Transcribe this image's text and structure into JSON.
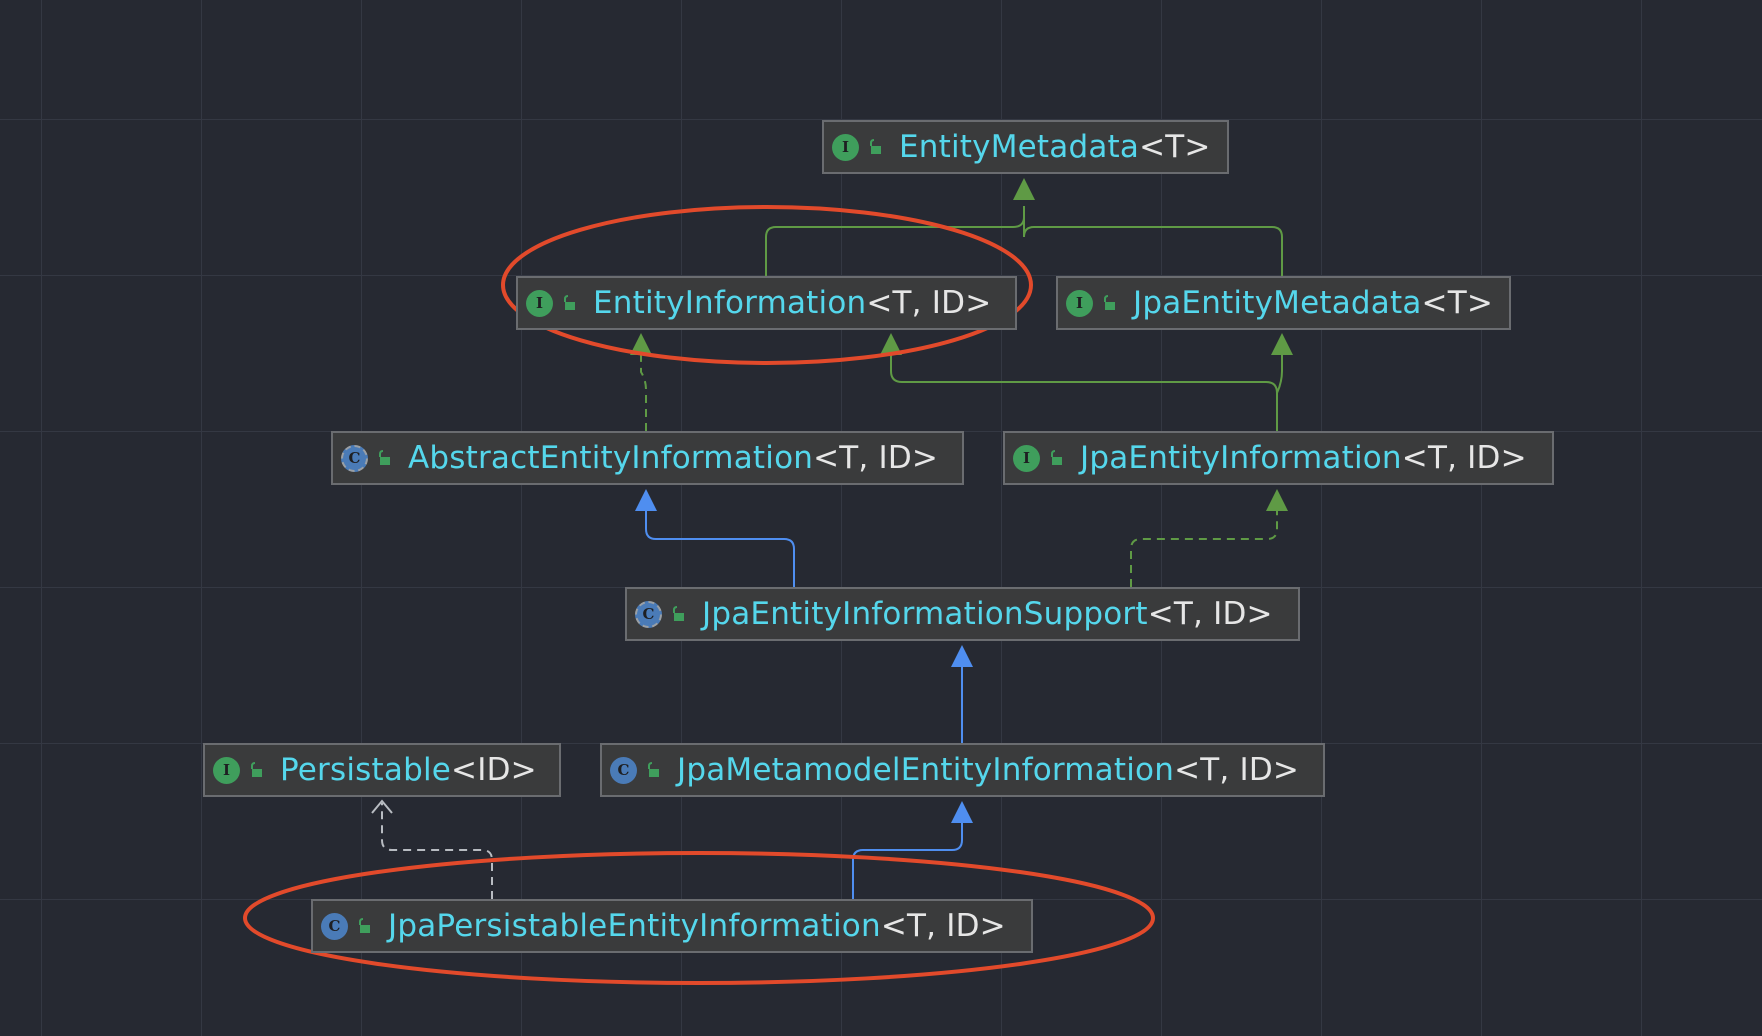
{
  "colors": {
    "background": "#262932",
    "grid": "#343843",
    "implements_edge": "#5f9a45",
    "extends_edge": "#4f8ef0",
    "dependency_edge": "#b8bcc2",
    "highlight": "#e24a2b",
    "class_name": "#55d7ec",
    "generics": "#e6e6e6"
  },
  "nodes": [
    {
      "id": "entity_metadata",
      "kind": "interface",
      "kind_letter": "I",
      "name": "EntityMetadata",
      "generics": "<T>"
    },
    {
      "id": "entity_information",
      "kind": "interface",
      "kind_letter": "I",
      "name": "EntityInformation",
      "generics": "<T, ID>"
    },
    {
      "id": "jpa_entity_metadata",
      "kind": "interface",
      "kind_letter": "I",
      "name": "JpaEntityMetadata",
      "generics": "<T>"
    },
    {
      "id": "abstract_entity_information",
      "kind": "abstract",
      "kind_letter": "C",
      "name": "AbstractEntityInformation",
      "generics": "<T, ID>"
    },
    {
      "id": "jpa_entity_information",
      "kind": "interface",
      "kind_letter": "I",
      "name": "JpaEntityInformation",
      "generics": "<T, ID>"
    },
    {
      "id": "jpa_entity_information_support",
      "kind": "abstract",
      "kind_letter": "C",
      "name": "JpaEntityInformationSupport",
      "generics": "<T, ID>"
    },
    {
      "id": "persistable",
      "kind": "interface",
      "kind_letter": "I",
      "name": "Persistable",
      "generics": "<ID>"
    },
    {
      "id": "jpa_metamodel_entity_information",
      "kind": "class",
      "kind_letter": "C",
      "name": "JpaMetamodelEntityInformation",
      "generics": "<T, ID>"
    },
    {
      "id": "jpa_persistable_entity_information",
      "kind": "class",
      "kind_letter": "C",
      "name": "JpaPersistableEntityInformation",
      "generics": "<T, ID>"
    }
  ],
  "edges": [
    {
      "from": "entity_information",
      "to": "entity_metadata",
      "type": "extends-interface"
    },
    {
      "from": "jpa_entity_metadata",
      "to": "entity_metadata",
      "type": "extends-interface"
    },
    {
      "from": "abstract_entity_information",
      "to": "entity_information",
      "type": "implements"
    },
    {
      "from": "jpa_entity_information",
      "to": "entity_information",
      "type": "extends-interface"
    },
    {
      "from": "jpa_entity_information",
      "to": "jpa_entity_metadata",
      "type": "extends-interface"
    },
    {
      "from": "jpa_entity_information_support",
      "to": "abstract_entity_information",
      "type": "extends"
    },
    {
      "from": "jpa_entity_information_support",
      "to": "jpa_entity_information",
      "type": "implements"
    },
    {
      "from": "jpa_metamodel_entity_information",
      "to": "jpa_entity_information_support",
      "type": "extends"
    },
    {
      "from": "jpa_persistable_entity_information",
      "to": "jpa_metamodel_entity_information",
      "type": "extends"
    },
    {
      "from": "jpa_persistable_entity_information",
      "to": "persistable",
      "type": "dependency"
    }
  ],
  "highlighted": [
    "entity_information",
    "jpa_persistable_entity_information"
  ]
}
